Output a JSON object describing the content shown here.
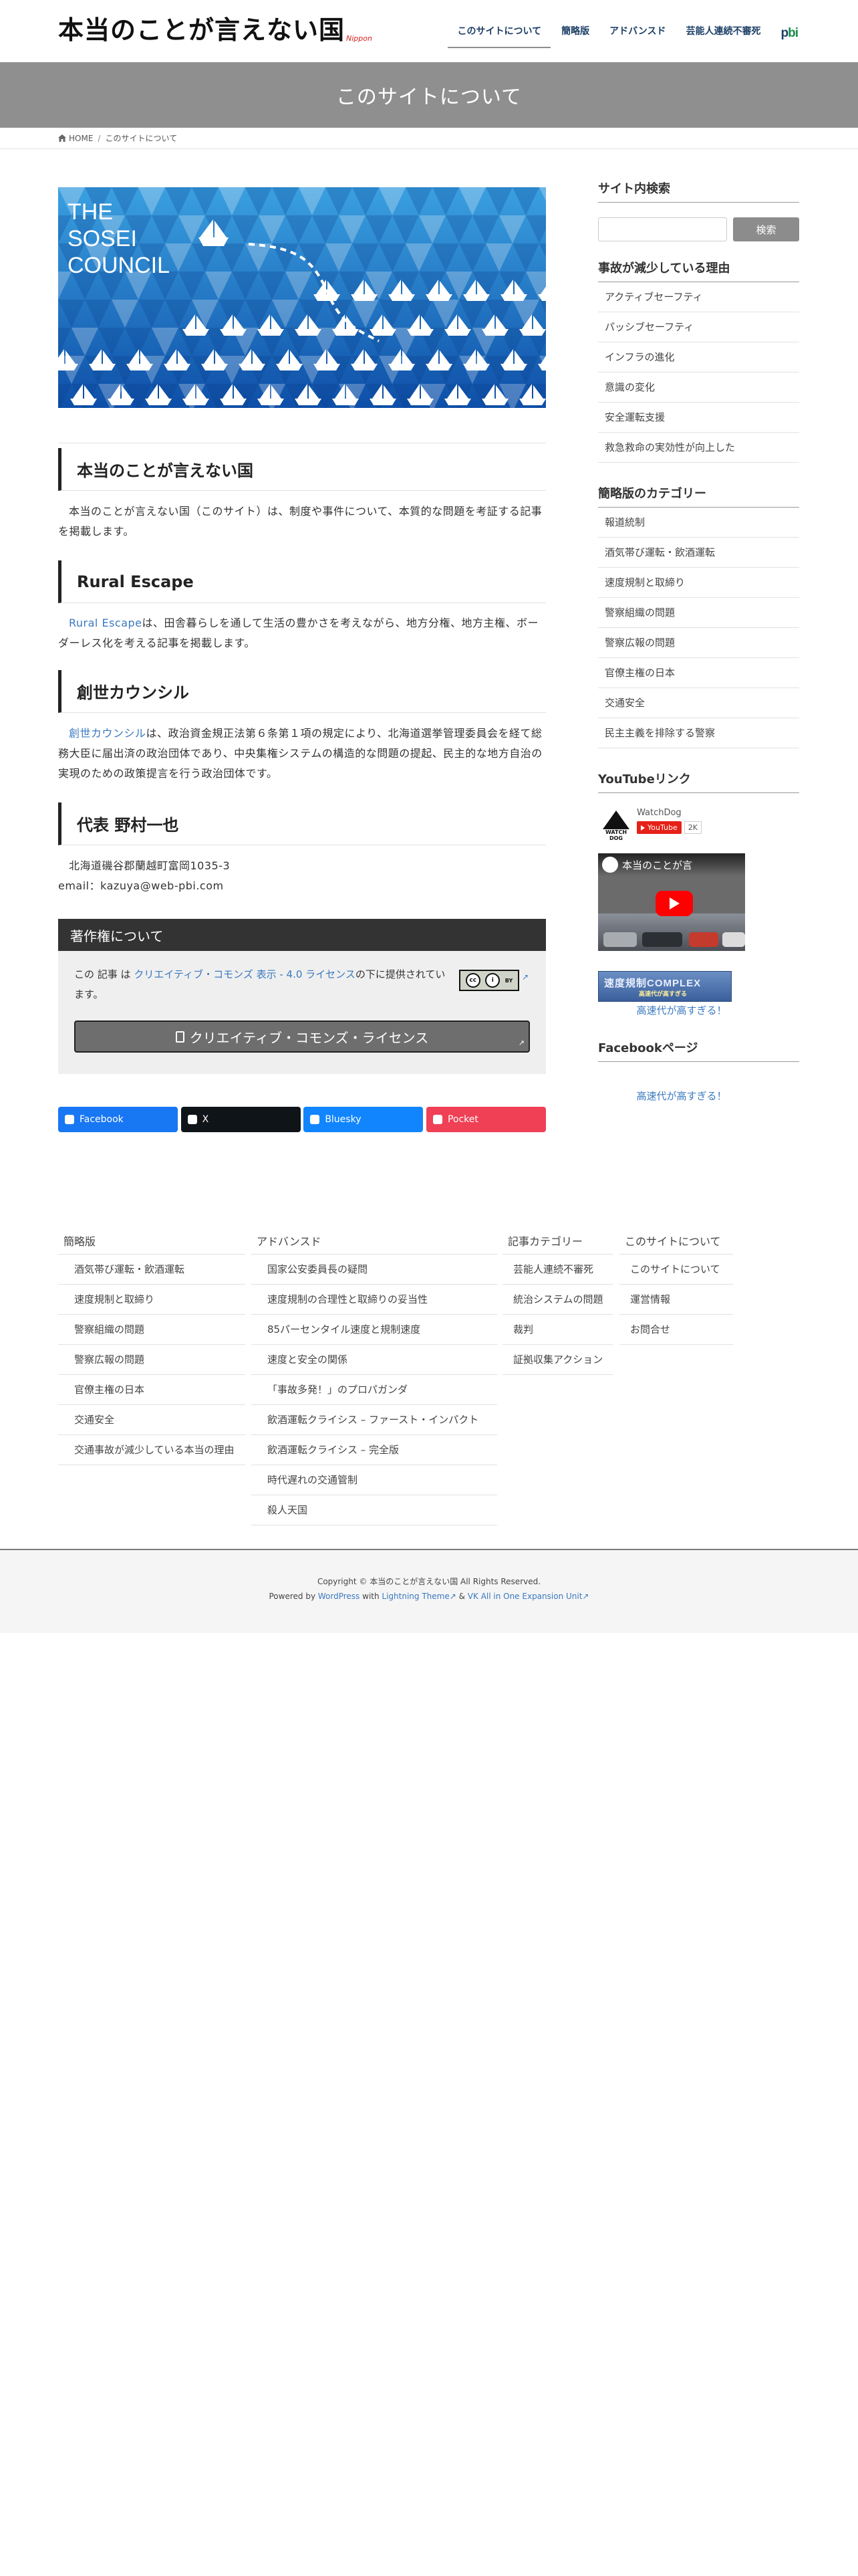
{
  "header": {
    "logo_text": "本当のことが言えない国",
    "logo_sub": "Nippon",
    "nav": [
      "このサイトについて",
      "簡略版",
      "アドバンスド",
      "芸能人連続不審死"
    ],
    "nav_logo_a": "p",
    "nav_logo_b": "bi"
  },
  "page_title": "このサイトについて",
  "breadcrumb": {
    "home": "HOME",
    "current": "このサイトについて"
  },
  "hero": {
    "lines": [
      "THE",
      "SOSEI",
      "COUNCIL"
    ]
  },
  "sections": [
    {
      "heading": "本当のことが言えない国",
      "text": "本当のことが言えない国（このサイト）は、制度や事件について、本質的な問題を考証する記事を掲載します。"
    },
    {
      "heading": "Rural Escape",
      "link": "Rural Escape",
      "text": "は、田舎暮らしを通して生活の豊かさを考えながら、地方分権、地方主権、ボーダーレス化を考える記事を掲載します。"
    },
    {
      "heading": "創世カウンシル",
      "link": "創世カウンシル",
      "text": "は、政治資金規正法第６条第１項の規定により、北海道選挙管理委員会を経て総務大臣に届出済の政治団体であり、中央集権システムの構造的な問題の提起、民主的な地方自治の実現のための政策提言を行う政治団体です。"
    },
    {
      "heading": "代表 野村一也",
      "address": "北海道磯谷郡蘭越町富岡1035-3",
      "email": "email：kazuya@web-pbi.com"
    }
  ],
  "copyright_box": {
    "title": "著作権について",
    "text_pre": "この 記事 は ",
    "link": "クリエイティブ・コモンズ 表示 - 4.0 ライセンス",
    "text_post": "の下に提供されています。",
    "badge": [
      "cc",
      "BY"
    ],
    "button": "クリエイティブ・コモンズ・ライセンス"
  },
  "share": [
    {
      "label": "Facebook",
      "color": "#1877f2"
    },
    {
      "label": "X",
      "color": "#0f1419"
    },
    {
      "label": "Bluesky",
      "color": "#1185fe"
    },
    {
      "label": "Pocket",
      "color": "#ef4056"
    }
  ],
  "sidebar": {
    "search_title": "サイト内検索",
    "search_placeholder": "",
    "search_button": "検索",
    "reasons_title": "事故が減少している理由",
    "reasons": [
      "アクティブセーフティ",
      "パッシブセーフティ",
      "インフラの進化",
      "意識の変化",
      "安全運転支援",
      "救急救命の実効性が向上した"
    ],
    "categories_title": "簡略版のカテゴリー",
    "categories": [
      "報道統制",
      "酒気帯び運転・飲酒運転",
      "速度規制と取締り",
      "警察組織の問題",
      "警察広報の問題",
      "官僚主権の日本",
      "交通安全",
      "民主主義を排除する警察"
    ],
    "youtube_title": "YouTubeリンク",
    "yt_channel": "WatchDog",
    "yt_avatar": "WATCH DOG",
    "yt_button": "YouTube",
    "yt_count": "2K",
    "yt_video_title": "本当のことが言",
    "banner_text": "速度規制COMPLEX",
    "banner_sub": "高速代が高すぎる",
    "link1": "高速代が高すぎる！",
    "facebook_title": "Facebookページ",
    "link2": "高速代が高すぎる！"
  },
  "footer": {
    "col1": {
      "title": "簡略版",
      "items": [
        "酒気帯び運転・飲酒運転",
        "速度規制と取締り",
        "警察組織の問題",
        "警察広報の問題",
        "官僚主権の日本",
        "交通安全",
        "交通事故が減少している本当の理由"
      ]
    },
    "col2": {
      "title": "アドバンスド",
      "items": [
        "国家公安委員長の疑問",
        "速度規制の合理性と取締りの妥当性",
        "85パーセンタイル速度と規制速度",
        "速度と安全の関係",
        "「事故多発！」のプロパガンダ",
        "飲酒運転クライシス – ファースト・インパクト",
        "飲酒運転クライシス – 完全版",
        "時代遅れの交通管制",
        "殺人天国"
      ]
    },
    "col3": {
      "title": "記事カテゴリー",
      "items": [
        "芸能人連続不審死",
        "統治システムの問題",
        "裁判",
        "証拠収集アクション"
      ]
    },
    "col4": {
      "title": "このサイトについて",
      "items": [
        "このサイトについて",
        "運営情報",
        "お問合せ"
      ]
    },
    "copyright": "Copyright © 本当のことが言えない国 All Rights Reserved.",
    "powered_pre": "Powered by ",
    "wp": "WordPress",
    "with": " with ",
    "theme": "Lightning Theme",
    "amp": " & ",
    "plugin": "VK All in One Expansion Unit"
  },
  "colors": {
    "accent": "#1d3f66",
    "link": "#3a79c0",
    "page_header": "#8f8f8f",
    "hero_blue": "#1a66b8"
  }
}
